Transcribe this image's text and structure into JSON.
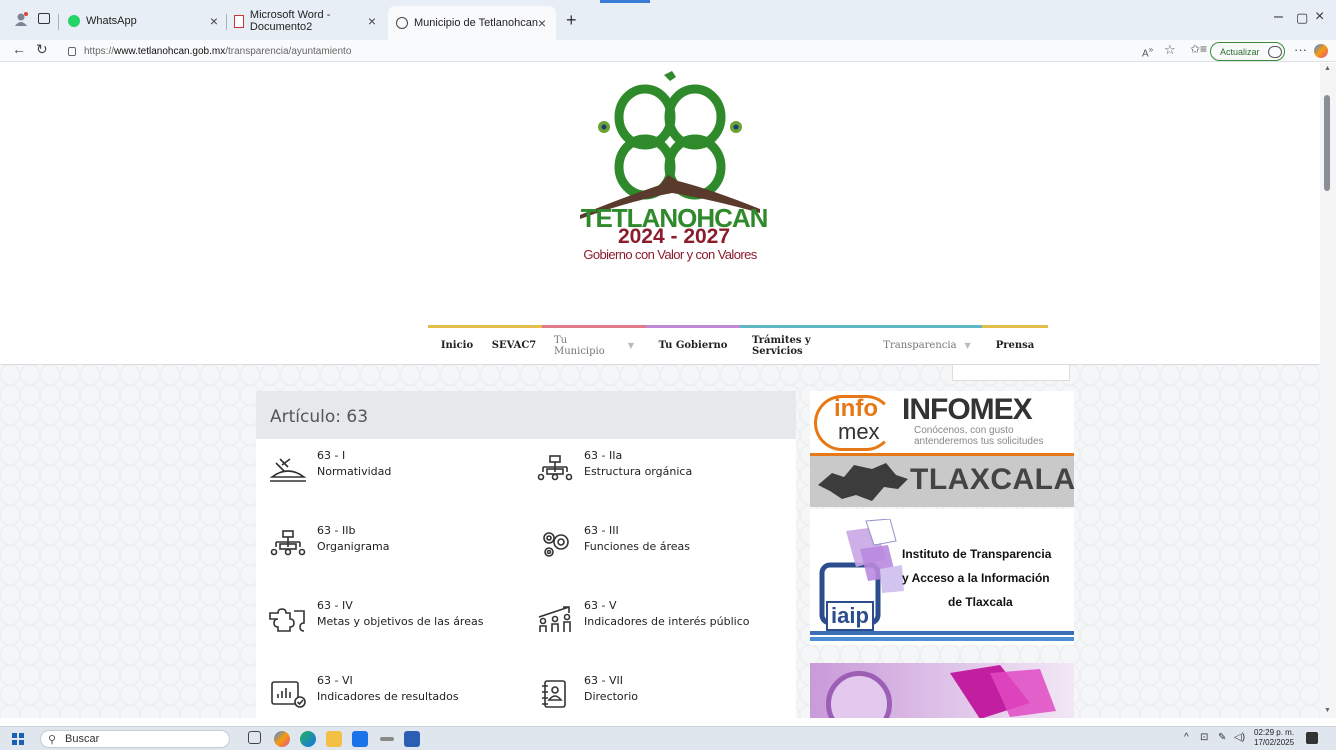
{
  "browser": {
    "tabs": [
      {
        "title": "WhatsApp",
        "active": false
      },
      {
        "title": "Microsoft Word - Documento2",
        "active": false
      },
      {
        "title": "Municipio de Tetlanohcan",
        "active": true
      }
    ],
    "url_prefix": "https://",
    "url_domain": "www.tetlanohcan.gob.mx",
    "url_path": "/transparencia/ayuntamiento",
    "update_label": "Actualizar"
  },
  "logo": {
    "name": "TETLANOHCAN",
    "years": "2024 - 2027",
    "slogan": "Gobierno con Valor y con Valores",
    "colors": {
      "green": "#2e8a2a",
      "maroon": "#8a1c2c",
      "mountain": "#5b3a2e"
    }
  },
  "nav": {
    "items": [
      {
        "label": "Inicio",
        "bold": true,
        "color": "#e4c04a"
      },
      {
        "label": "SEVAC7",
        "bold": true,
        "color": "#e4c04a"
      },
      {
        "label": "Tu Municipio",
        "bold": false,
        "dropdown": true,
        "color": "#e07a8a"
      },
      {
        "label": "Tu Gobierno",
        "bold": true,
        "color": "#c08ad8"
      },
      {
        "label": "Trámites y Servicios",
        "bold": true,
        "color": "#5fb7c2"
      },
      {
        "label": "Transparencia",
        "bold": false,
        "dropdown": true,
        "color": "#5fb7c2"
      },
      {
        "label": "Prensa",
        "bold": true,
        "color": "#e4c04a"
      }
    ]
  },
  "article": {
    "heading": "Artículo: 63",
    "items": [
      {
        "code": "63 - I",
        "label": "Normatividad",
        "icon": "gavel-icon"
      },
      {
        "code": "63 - IIa",
        "label": "Estructura orgánica",
        "icon": "org-chart-icon"
      },
      {
        "code": "63 - IIb",
        "label": "Organigrama",
        "icon": "org-chart-icon"
      },
      {
        "code": "63 - III",
        "label": "Funciones de áreas",
        "icon": "gears-icon"
      },
      {
        "code": "63 - IV",
        "label": "Metas y objetivos de las áreas",
        "icon": "puzzle-icon"
      },
      {
        "code": "63 - V",
        "label": "Indicadores de interés público",
        "icon": "people-growth-icon"
      },
      {
        "code": "63 - VI",
        "label": "Indicadores de resultados",
        "icon": "chart-check-icon"
      },
      {
        "code": "63 - VII",
        "label": "Directorio",
        "icon": "contacts-book-icon"
      }
    ]
  },
  "banners": {
    "infomex_logo_top": "info",
    "infomex_logo_bottom": "mex",
    "infomex_title": "INFOMEX",
    "infomex_sub1": "Conócenos, con gusto",
    "infomex_sub2": "antenderemos tus solicitudes",
    "tlaxcala": "TLAXCALA",
    "iaip_logo": "iaip",
    "iaip_line1": "Instituto de Transparencia",
    "iaip_line2": "y Acceso a la Información",
    "iaip_line3": "de Tlaxcala"
  },
  "taskbar": {
    "search_placeholder": "Buscar",
    "time": "02:29 p. m.",
    "date": "17/02/2025"
  }
}
